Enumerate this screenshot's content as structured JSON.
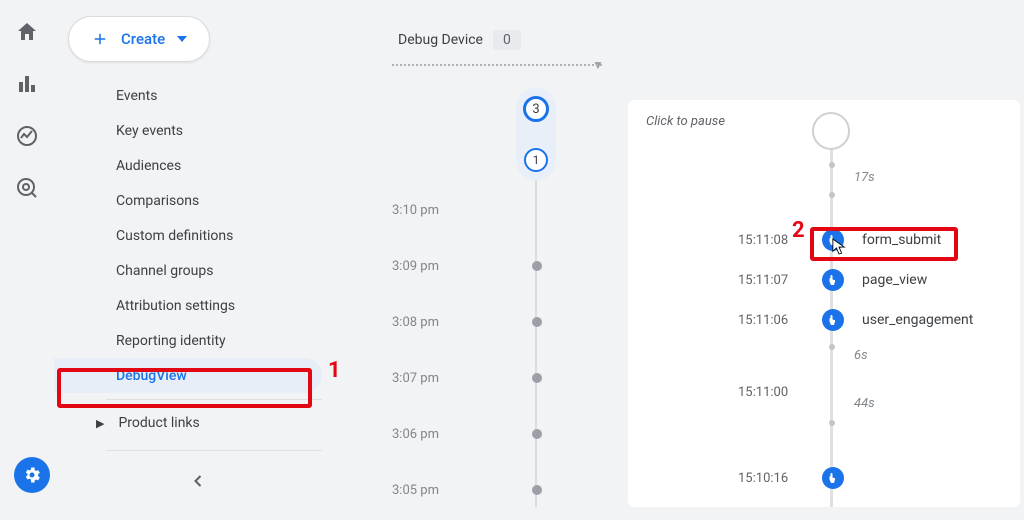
{
  "iconbar": {
    "items": [
      "home-icon",
      "bar-chart-icon",
      "trend-icon",
      "target-icon"
    ]
  },
  "create": {
    "label": "Create"
  },
  "sidebar": {
    "items": [
      {
        "label": "Events"
      },
      {
        "label": "Key events"
      },
      {
        "label": "Audiences"
      },
      {
        "label": "Comparisons"
      },
      {
        "label": "Custom definitions"
      },
      {
        "label": "Channel groups"
      },
      {
        "label": "Attribution settings"
      },
      {
        "label": "Reporting identity"
      },
      {
        "label": "DebugView",
        "selected": true
      }
    ],
    "product_links": "Product links"
  },
  "debug_device": {
    "label": "Debug Device",
    "count": "0"
  },
  "minute_line": {
    "pill_top": "3",
    "pill_bottom": "1",
    "rows": [
      {
        "time": "3:10 pm"
      },
      {
        "time": "3:09 pm"
      },
      {
        "time": "3:08 pm"
      },
      {
        "time": "3:07 pm"
      },
      {
        "time": "3:06 pm"
      },
      {
        "time": "3:05 pm"
      }
    ]
  },
  "detail": {
    "click_to_pause": "Click to pause",
    "gap1": "17s",
    "rows": [
      {
        "time": "15:11:08",
        "label": "form_submit"
      },
      {
        "time": "15:11:07",
        "label": "page_view"
      },
      {
        "time": "15:11:06",
        "label": "user_engagement"
      }
    ],
    "gap2": "6s",
    "time_after_gap2": "15:11:00",
    "gap3": "44s",
    "time_bottom": "15:10:16"
  },
  "annotations": {
    "one": "1",
    "two": "2"
  }
}
